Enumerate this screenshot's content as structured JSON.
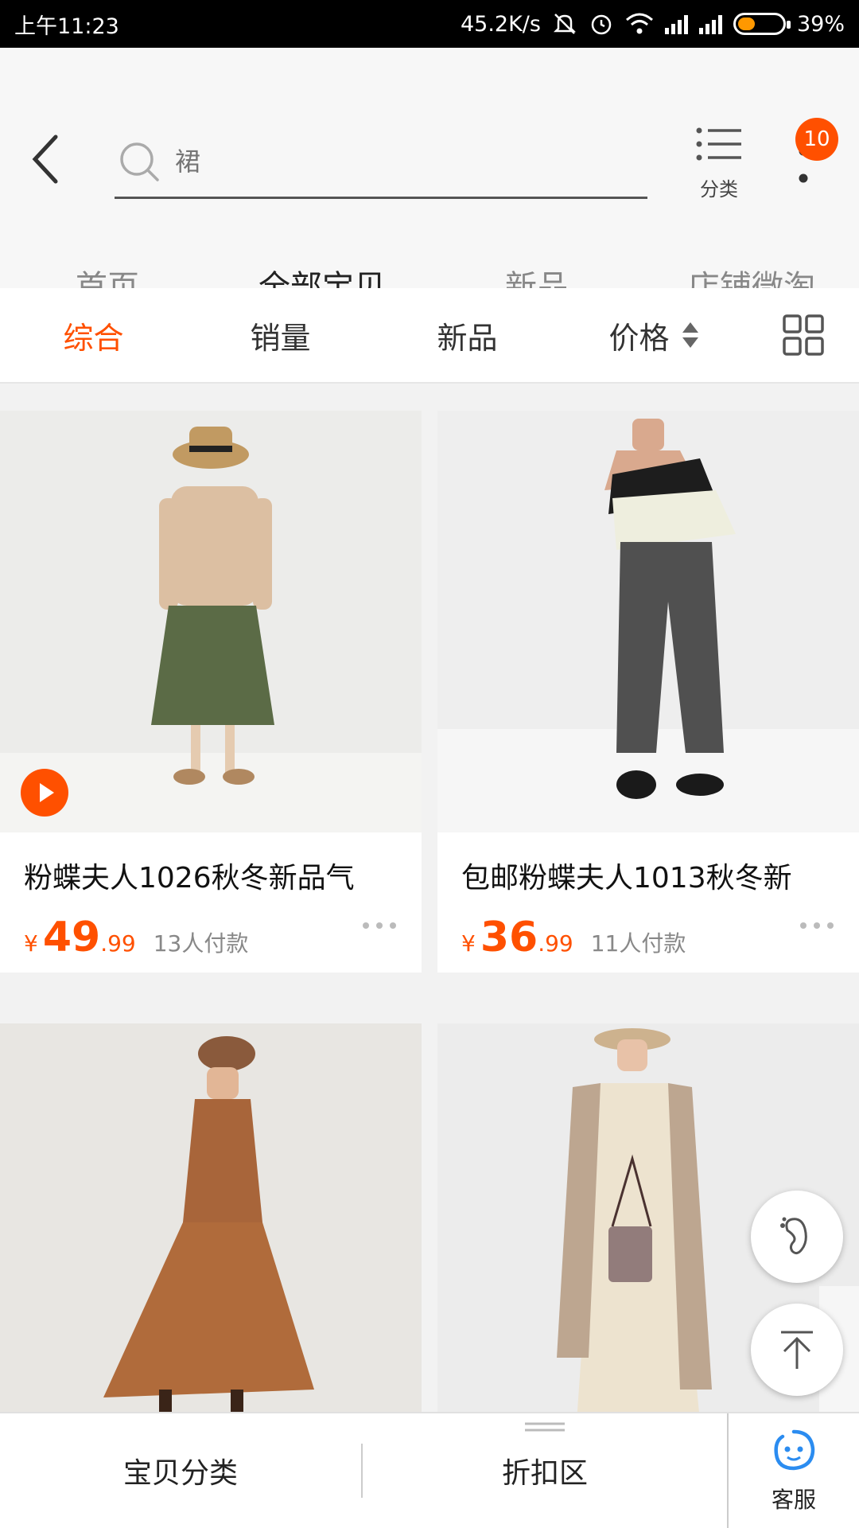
{
  "status_bar": {
    "time": "上午11:23",
    "net_speed": "45.2K/s",
    "battery_percent": "39%",
    "battery_level": 0.39,
    "icons": [
      "mute-icon",
      "alarm-icon",
      "wifi-icon",
      "signal-icon",
      "signal-icon",
      "battery-icon"
    ]
  },
  "header": {
    "search_placeholder": "裙",
    "category_label": "分类",
    "message_count": "10"
  },
  "shop_tabs": [
    "首页",
    "全部宝贝",
    "新品",
    "店铺微淘"
  ],
  "active_shop_tab": 1,
  "sort_bar": {
    "items": [
      "综合",
      "销量",
      "新品",
      "价格"
    ],
    "active_color": "#ff5000"
  },
  "products": [
    {
      "title": "粉蝶夫人1026秋冬新品气",
      "currency": "¥",
      "price_int": "49",
      "price_dec": ".99",
      "sold": "13人付款",
      "has_video": true
    },
    {
      "title": "包邮粉蝶夫人1013秋冬新",
      "currency": "¥",
      "price_int": "36",
      "price_dec": ".99",
      "sold": "11人付款",
      "has_video": false
    },
    {
      "title": "",
      "has_video": false
    },
    {
      "title": "",
      "has_video": false
    }
  ],
  "bottom_bar": {
    "category_label": "宝贝分类",
    "discount_label": "折扣区",
    "service_label": "客服"
  },
  "colors": {
    "accent": "#ff5000",
    "service_icon": "#2b8cf0"
  }
}
